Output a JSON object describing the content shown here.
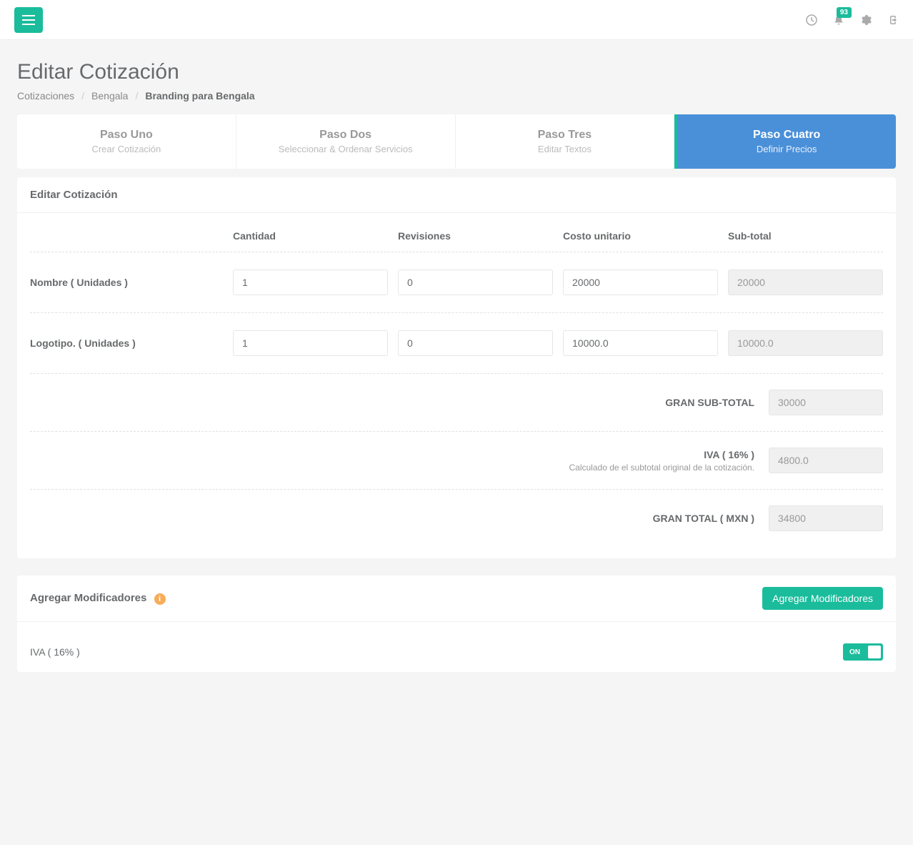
{
  "topbar": {
    "notification_count": "93"
  },
  "page": {
    "title": "Editar Cotización",
    "breadcrumb": {
      "item1": "Cotizaciones",
      "item2": "Bengala",
      "item3": "Branding para Bengala"
    }
  },
  "steps": [
    {
      "title": "Paso Uno",
      "subtitle": "Crear Cotización"
    },
    {
      "title": "Paso Dos",
      "subtitle": "Seleccionar & Ordenar Servicios"
    },
    {
      "title": "Paso Tres",
      "subtitle": "Editar Textos"
    },
    {
      "title": "Paso Cuatro",
      "subtitle": "Definir Precios"
    }
  ],
  "edit_panel": {
    "title": "Editar Cotización",
    "headers": {
      "cantidad": "Cantidad",
      "revisiones": "Revisiones",
      "costo": "Costo unitario",
      "subtotal": "Sub-total"
    },
    "rows": [
      {
        "label": "Nombre ( Unidades )",
        "cantidad": "1",
        "revisiones": "0",
        "costo": "20000",
        "subtotal": "20000"
      },
      {
        "label": "Logotipo. ( Unidades )",
        "cantidad": "1",
        "revisiones": "0",
        "costo": "10000.0",
        "subtotal": "10000.0"
      }
    ],
    "totals": {
      "gran_subtotal_label": "GRAN SUB-TOTAL",
      "gran_subtotal_value": "30000",
      "iva_label": "IVA ( 16% )",
      "iva_sub": "Calculado de el subtotal original de la cotización.",
      "iva_value": "4800.0",
      "gran_total_label": "GRAN TOTAL ( MXN )",
      "gran_total_value": "34800"
    }
  },
  "modifiers": {
    "title": "Agregar Modificadores",
    "button": "Agregar Modificadores",
    "row1_label": "IVA ( 16% )",
    "toggle_on": "ON"
  }
}
